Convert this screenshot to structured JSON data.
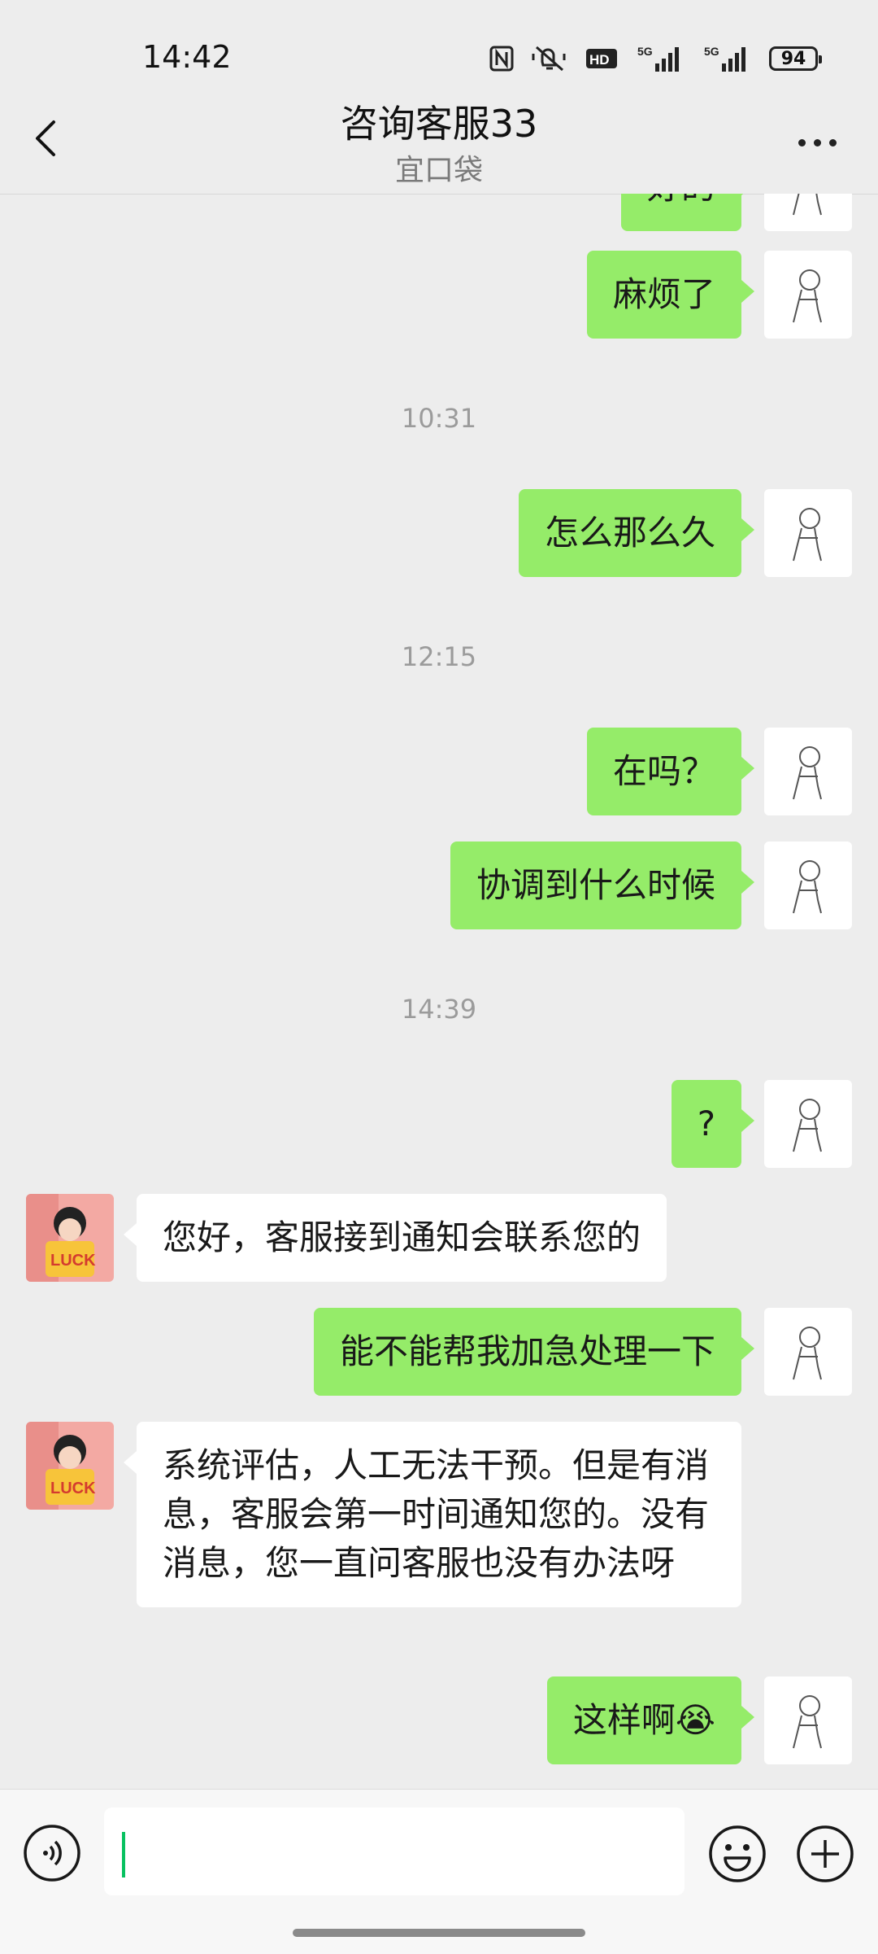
{
  "status_bar": {
    "time": "14:42",
    "icons": [
      "nfc-icon",
      "mute-icon",
      "hd-icon",
      "signal-5g-icon",
      "signal-5g-icon"
    ],
    "battery": "94"
  },
  "header": {
    "title": "咨询客服33",
    "subtitle": "宜口袋"
  },
  "messages": {
    "m0": "好的",
    "m1": "麻烦了",
    "t1": "10:31",
    "m2": "怎么那么久",
    "t2": "12:15",
    "m3": "在吗？",
    "m4": "协调到什么时候",
    "t3": "14:39",
    "m5": "?",
    "m6": "您好，客服接到通知会联系您的",
    "m7": "能不能帮我加急处理一下",
    "m8": "系统评估，人工无法干预。但是有消息，客服会第一时间通知您的。没有消息，您一直问客服也没有办法呀",
    "m9": "这样啊😭"
  },
  "input": {
    "value": ""
  },
  "colors": {
    "my_bubble": "#95ec69",
    "their_bubble": "#ffffff",
    "background": "#ededed",
    "caret": "#07c160"
  }
}
